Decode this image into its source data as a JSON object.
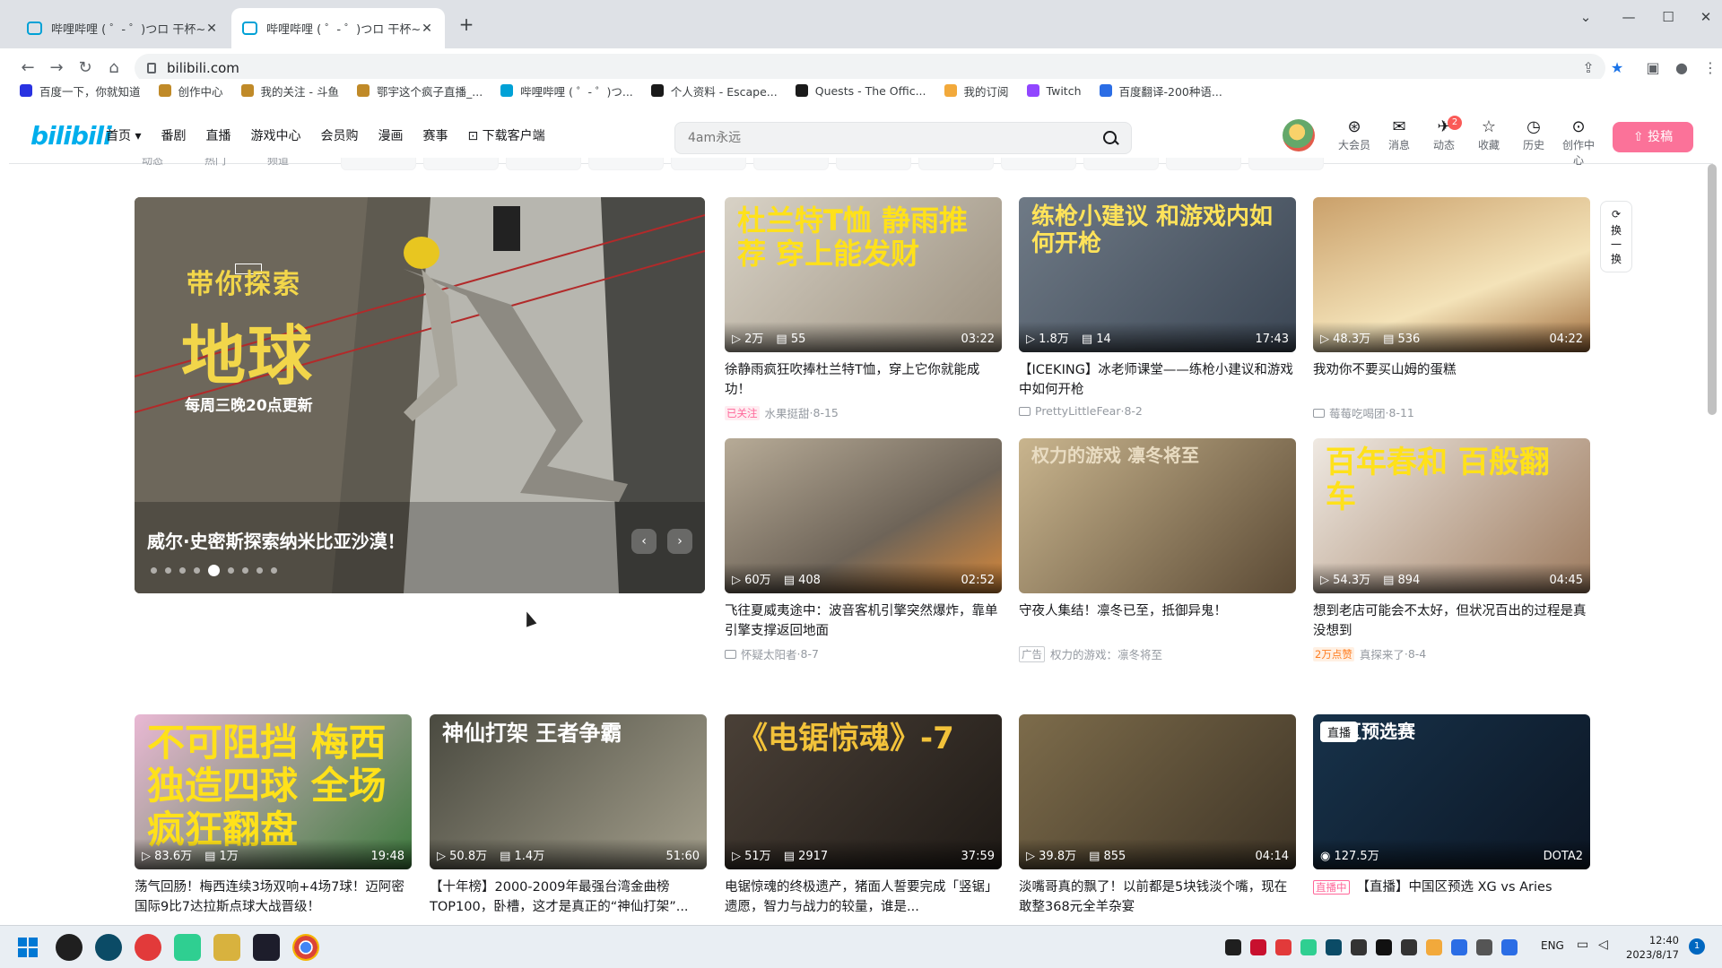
{
  "browser": {
    "tabs": [
      {
        "title": "哔哩哔哩 ( ゜- ゜)つロ 干杯~-bilibili"
      },
      {
        "title": "哔哩哔哩 ( ゜- ゜)つロ 干杯~-bilibili"
      }
    ],
    "url": "bilibili.com",
    "bookmarks": [
      {
        "label": "百度一下，你就知道",
        "color": "#2932e1"
      },
      {
        "label": "创作中心",
        "color": "#c08a28"
      },
      {
        "label": "我的关注 - 斗鱼",
        "color": "#c08a28"
      },
      {
        "label": "鄂宇这个疯子直播_...",
        "color": "#c08a28"
      },
      {
        "label": "哔哩哔哩 ( ゜- ゜)つ...",
        "color": "#00a1d6"
      },
      {
        "label": "个人资料 - Escape...",
        "color": "#1a1a1a"
      },
      {
        "label": "Quests - The Offic...",
        "color": "#1a1a1a"
      },
      {
        "label": "我的订阅",
        "color": "#f2a93b"
      },
      {
        "label": "Twitch",
        "color": "#9146ff"
      },
      {
        "label": "百度翻译-200种语...",
        "color": "#2b6de5"
      }
    ]
  },
  "header": {
    "logo": "bilibili",
    "nav": [
      "首页",
      "番剧",
      "直播",
      "游戏中心",
      "会员购",
      "漫画",
      "赛事",
      "下载客户端"
    ],
    "search_placeholder": "4am永远",
    "icons": [
      {
        "label": "大会员",
        "glyph": "⊛"
      },
      {
        "label": "消息",
        "glyph": "✉"
      },
      {
        "label": "动态",
        "glyph": "✈",
        "badge": "2"
      },
      {
        "label": "收藏",
        "glyph": "☆"
      },
      {
        "label": "历史",
        "glyph": "◷"
      },
      {
        "label": "创作中心",
        "glyph": "⊙"
      }
    ],
    "upload": "投稿"
  },
  "subnav": {
    "items": [
      "动态",
      "热门",
      "频道"
    ]
  },
  "banner": {
    "tag": "带你探索",
    "big": "地球",
    "schedule": "每周三晚20点更新",
    "caption": "威尔·史密斯探索纳米比亚沙漠！",
    "dots": 9,
    "active_dot": 5
  },
  "refresh": {
    "label": "换一换"
  },
  "cards": [
    {
      "title": "徐静雨疯狂吹捧杜兰特T恤，穿上它你就能成功！",
      "plays": "2万",
      "danmaku": "55",
      "duration": "03:22",
      "tag": "已关注",
      "tag_type": "follow",
      "author": "水果挺甜",
      "date": "8-15",
      "overlay": "杜兰特T恤 静雨推荐 穿上能发财"
    },
    {
      "title": "【ICEKING】冰老师课堂——练枪小建议和游戏中如何开枪",
      "plays": "1.8万",
      "danmaku": "14",
      "duration": "17:43",
      "author": "PrettyLittleFear",
      "date": "8-2",
      "overlay": "练枪小建议 和游戏内如何开枪"
    },
    {
      "title": "我劝你不要买山姆的蛋糕",
      "plays": "48.3万",
      "danmaku": "536",
      "duration": "04:22",
      "author": "莓莓吃喝团",
      "date": "8-11",
      "overlay": ""
    },
    {
      "title": "飞往夏威夷途中：波音客机引擎突然爆炸，靠单引擎支撑返回地面",
      "plays": "60万",
      "danmaku": "408",
      "duration": "02:52",
      "author": "怀疑太阳者",
      "date": "8-7",
      "overlay": ""
    },
    {
      "title": "守夜人集结！凛冬已至，抵御异鬼！",
      "tag": "广告",
      "tag_type": "ad",
      "author": "权力的游戏：凛冬将至",
      "overlay": "权力的游戏 凛冬将至"
    },
    {
      "title": "想到老店可能会不太好，但状况百出的过程是真没想到",
      "plays": "54.3万",
      "danmaku": "894",
      "duration": "04:45",
      "tag": "2万点赞",
      "tag_type": "likes",
      "author": "真探来了",
      "date": "8-4",
      "overlay": "百年春和 百般翻车"
    },
    {
      "title": "荡气回肠！梅西连续3场双响+4场7球！迈阿密国际9比7达拉斯点球大战晋级！",
      "plays": "83.6万",
      "danmaku": "1万",
      "duration": "19:48",
      "overlay": "不可阻挡 梅西独造四球 全场疯狂翻盘"
    },
    {
      "title": "【十年榜】2000-2009年最强台湾金曲榜TOP100，卧槽，这才是真正的“神仙打架”...",
      "plays": "50.8万",
      "danmaku": "1.4万",
      "duration": "51:60",
      "overlay": "神仙打架 王者争霸"
    },
    {
      "title": "电锯惊魂的终极遗产，猪面人誓要完成「竖锯」遗愿，智力与战力的较量，谁是...",
      "plays": "51万",
      "danmaku": "2917",
      "duration": "37:59",
      "overlay": "《电锯惊魂》-7"
    },
    {
      "title": "淡嘴哥真的飘了！以前都是5块钱淡个嘴，现在敢整368元全羊杂宴",
      "plays": "39.8万",
      "danmaku": "855",
      "duration": "04:14",
      "overlay": ""
    },
    {
      "title": "【直播】中国区预选 XG vs Aries",
      "live_badge": "直播",
      "viewers": "127.5万",
      "game": "DOTA2",
      "tag": "直播中",
      "tag_type": "live",
      "overlay": "地区预选赛"
    }
  ],
  "taskbar": {
    "lang": "ENG",
    "time": "12:40",
    "date": "2023/8/17",
    "notifications": "1"
  }
}
